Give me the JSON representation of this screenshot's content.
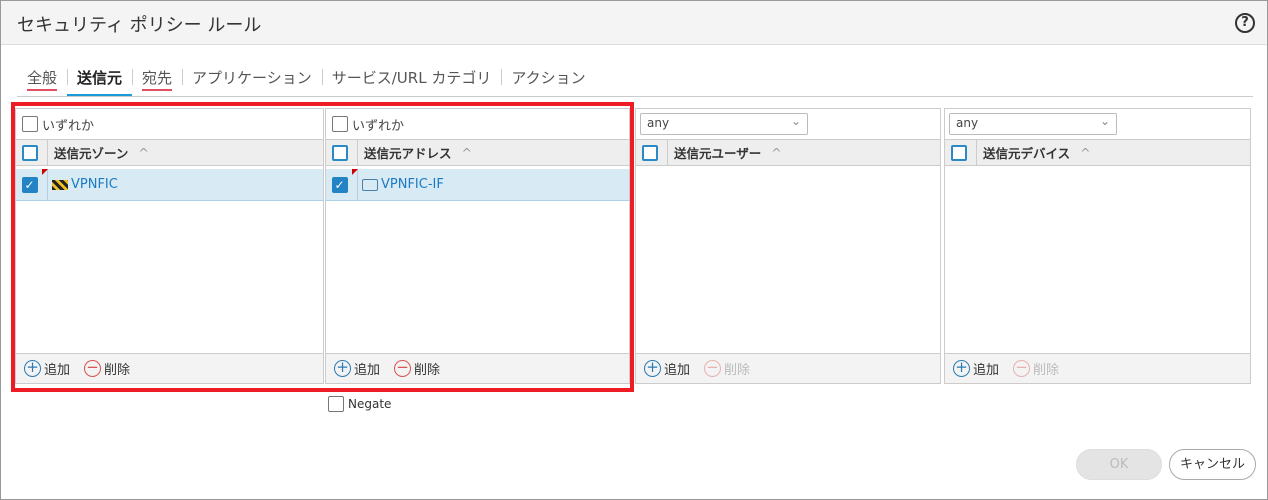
{
  "title": "セキュリティ ポリシー ルール",
  "help": "?",
  "tabs": [
    "全般",
    "送信元",
    "宛先",
    "アプリケーション",
    "サービス/URL カテゴリ",
    "アクション"
  ],
  "panels": [
    {
      "top": "いずれか",
      "header": "送信元ゾーン",
      "rows": [
        "VPNFIC"
      ],
      "add": "追加",
      "del": "削除"
    },
    {
      "top": "いずれか",
      "header": "送信元アドレス",
      "rows": [
        "VPNFIC-IF"
      ],
      "add": "追加",
      "del": "削除"
    },
    {
      "select": "any",
      "header": "送信元ユーザー",
      "add": "追加",
      "del": "削除"
    },
    {
      "select": "any",
      "header": "送信元デバイス",
      "add": "追加",
      "del": "削除"
    }
  ],
  "negate": "Negate",
  "ok": "OK",
  "cancel": "キャンセル"
}
